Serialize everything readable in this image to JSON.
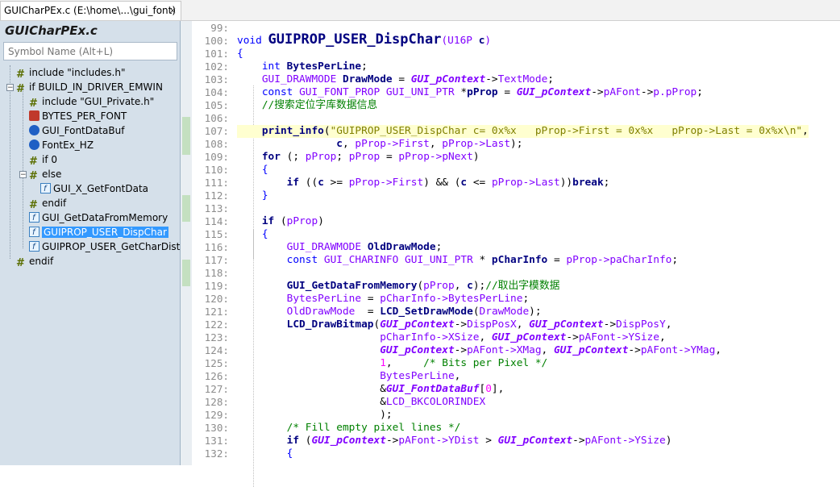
{
  "tab": {
    "title": "GUICharPEx.c (E:\\home\\...\\gui_font)",
    "close": "×"
  },
  "sidebar": {
    "title": "GUICharPEx.c",
    "search_placeholder": "Symbol Name (Alt+L)",
    "items": [
      {
        "label": "include \"includes.h\"",
        "icon": "include-icon"
      },
      {
        "label": "if BUILD_IN_DRIVER_EMWIN",
        "icon": "preprocessor-if-icon"
      },
      {
        "label": "include \"GUI_Private.h\"",
        "icon": "include-icon"
      },
      {
        "label": "BYTES_PER_FONT",
        "icon": "define-icon"
      },
      {
        "label": "GUI_FontDataBuf",
        "icon": "variable-icon"
      },
      {
        "label": "FontEx_HZ",
        "icon": "variable-icon"
      },
      {
        "label": "if 0",
        "icon": "preprocessor-if-icon"
      },
      {
        "label": "else",
        "icon": "preprocessor-else-icon"
      },
      {
        "label": "GUI_X_GetFontData",
        "icon": "function-icon"
      },
      {
        "label": "endif",
        "icon": "preprocessor-endif-icon"
      },
      {
        "label": "GUI_GetDataFromMemory",
        "icon": "function-icon"
      },
      {
        "label": "GUIPROP_USER_DispChar",
        "icon": "function-icon",
        "selected": true
      },
      {
        "label": "GUIPROP_USER_GetCharDist",
        "icon": "function-icon"
      },
      {
        "label": "endif",
        "icon": "preprocessor-endif-icon"
      }
    ]
  },
  "editor": {
    "line_numbers": [
      "99:",
      "100:",
      "101:",
      "102:",
      "103:",
      "104:",
      "105:",
      "106:",
      "107:",
      "108:",
      "109:",
      "110:",
      "111:",
      "112:",
      "113:",
      "114:",
      "115:",
      "116:",
      "117:",
      "118:",
      "119:",
      "120:",
      "121:",
      "122:",
      "123:",
      "124:",
      "125:",
      "126:",
      "127:",
      "128:",
      "129:",
      "130:",
      "131:",
      "132:"
    ],
    "lines": [
      [],
      [
        [
          "kw",
          "void "
        ],
        [
          "fnbig",
          "GUIPROP_USER_DispChar"
        ],
        [
          "mac",
          "(U16P "
        ],
        [
          "kwb",
          "c"
        ],
        [
          "mac",
          ")"
        ]
      ],
      [
        [
          "kw",
          "{"
        ]
      ],
      [
        [
          "op",
          "    "
        ],
        [
          "kw",
          "int "
        ],
        [
          "kwb",
          "BytesPerLine"
        ],
        [
          "op",
          ";"
        ]
      ],
      [
        [
          "op",
          "    "
        ],
        [
          "ty",
          "GUI_DRAWMODE "
        ],
        [
          "kwb",
          "DrawMode "
        ],
        [
          "op",
          "= "
        ],
        [
          "gl",
          "GUI_pContext"
        ],
        [
          "op",
          "->"
        ],
        [
          "mac",
          "TextMode"
        ],
        [
          "op",
          ";"
        ]
      ],
      [
        [
          "op",
          "    "
        ],
        [
          "kw",
          "const "
        ],
        [
          "ty",
          "GUI_FONT_PROP GUI_UNI_PTR "
        ],
        [
          "op",
          "*"
        ],
        [
          "kwb",
          "pProp "
        ],
        [
          "op",
          "= "
        ],
        [
          "gl",
          "GUI_pContext"
        ],
        [
          "op",
          "->"
        ],
        [
          "mac",
          "pAFont"
        ],
        [
          "op",
          "->"
        ],
        [
          "mac",
          "p.pProp"
        ],
        [
          "op",
          ";"
        ]
      ],
      [
        [
          "op",
          "    "
        ],
        [
          "cm",
          "//搜索定位字库数据信息"
        ]
      ],
      [],
      [
        [
          "op",
          "    "
        ],
        [
          "fn",
          "print_info"
        ],
        [
          "op",
          "("
        ],
        [
          "st",
          "\"GUIPROP_USER_DispChar c= 0x%x   pProp->First = 0x%x   pProp->Last = 0x%x\\n\""
        ],
        [
          "op",
          ","
        ]
      ],
      [
        [
          "op",
          "                "
        ],
        [
          "kwb",
          "c"
        ],
        [
          "op",
          ", "
        ],
        [
          "mac",
          "pProp->First"
        ],
        [
          "op",
          ", "
        ],
        [
          "mac",
          "pProp->Last"
        ],
        [
          "op",
          ");"
        ]
      ],
      [
        [
          "op",
          "    "
        ],
        [
          "kwb",
          "for "
        ],
        [
          "op",
          "(; "
        ],
        [
          "mac",
          "pProp"
        ],
        [
          "op",
          "; "
        ],
        [
          "mac",
          "pProp "
        ],
        [
          "op",
          "= "
        ],
        [
          "mac",
          "pProp->pNext"
        ],
        [
          "op",
          ")"
        ]
      ],
      [
        [
          "op",
          "    "
        ],
        [
          "kw",
          "{"
        ]
      ],
      [
        [
          "op",
          "        "
        ],
        [
          "kwb",
          "if "
        ],
        [
          "op",
          "(("
        ],
        [
          "kwb",
          "c "
        ],
        [
          "op",
          ">= "
        ],
        [
          "mac",
          "pProp->First"
        ],
        [
          "op",
          ") && ("
        ],
        [
          "kwb",
          "c "
        ],
        [
          "op",
          "<= "
        ],
        [
          "mac",
          "pProp->Last"
        ],
        [
          "op",
          "))"
        ],
        [
          "kwb",
          "break"
        ],
        [
          "op",
          ";"
        ]
      ],
      [
        [
          "op",
          "    "
        ],
        [
          "kw",
          "}"
        ]
      ],
      [],
      [
        [
          "op",
          "    "
        ],
        [
          "kwb",
          "if "
        ],
        [
          "op",
          "("
        ],
        [
          "mac",
          "pProp"
        ],
        [
          "op",
          ")"
        ]
      ],
      [
        [
          "op",
          "    "
        ],
        [
          "kw",
          "{"
        ]
      ],
      [
        [
          "op",
          "        "
        ],
        [
          "ty",
          "GUI_DRAWMODE "
        ],
        [
          "kwb",
          "OldDrawMode"
        ],
        [
          "op",
          ";"
        ]
      ],
      [
        [
          "op",
          "        "
        ],
        [
          "kw",
          "const "
        ],
        [
          "ty",
          "GUI_CHARINFO GUI_UNI_PTR "
        ],
        [
          "op",
          "* "
        ],
        [
          "kwb",
          "pCharInfo "
        ],
        [
          "op",
          "= "
        ],
        [
          "mac",
          "pProp->paCharInfo"
        ],
        [
          "op",
          ";"
        ]
      ],
      [],
      [
        [
          "op",
          "        "
        ],
        [
          "fn",
          "GUI_GetDataFromMemory"
        ],
        [
          "op",
          "("
        ],
        [
          "mac",
          "pProp"
        ],
        [
          "op",
          ", "
        ],
        [
          "kwb",
          "c"
        ],
        [
          "op",
          ");"
        ],
        [
          "cm",
          "//取出字模数据"
        ]
      ],
      [
        [
          "op",
          "        "
        ],
        [
          "mac",
          "BytesPerLine "
        ],
        [
          "op",
          "= "
        ],
        [
          "mac",
          "pCharInfo->BytesPerLine"
        ],
        [
          "op",
          ";"
        ]
      ],
      [
        [
          "op",
          "        "
        ],
        [
          "mac",
          "OldDrawMode  "
        ],
        [
          "op",
          "= "
        ],
        [
          "fn",
          "LCD_SetDrawMode"
        ],
        [
          "op",
          "("
        ],
        [
          "mac",
          "DrawMode"
        ],
        [
          "op",
          ");"
        ]
      ],
      [
        [
          "op",
          "        "
        ],
        [
          "fn",
          "LCD_DrawBitmap"
        ],
        [
          "op",
          "("
        ],
        [
          "gl",
          "GUI_pContext"
        ],
        [
          "op",
          "->"
        ],
        [
          "mac",
          "DispPosX"
        ],
        [
          "op",
          ", "
        ],
        [
          "gl",
          "GUI_pContext"
        ],
        [
          "op",
          "->"
        ],
        [
          "mac",
          "DispPosY"
        ],
        [
          "op",
          ","
        ]
      ],
      [
        [
          "op",
          "                       "
        ],
        [
          "mac",
          "pCharInfo->XSize"
        ],
        [
          "op",
          ", "
        ],
        [
          "gl",
          "GUI_pContext"
        ],
        [
          "op",
          "->"
        ],
        [
          "mac",
          "pAFont->YSize"
        ],
        [
          "op",
          ","
        ]
      ],
      [
        [
          "op",
          "                       "
        ],
        [
          "gl",
          "GUI_pContext"
        ],
        [
          "op",
          "->"
        ],
        [
          "mac",
          "pAFont->XMag"
        ],
        [
          "op",
          ", "
        ],
        [
          "gl",
          "GUI_pContext"
        ],
        [
          "op",
          "->"
        ],
        [
          "mac",
          "pAFont->YMag"
        ],
        [
          "op",
          ","
        ]
      ],
      [
        [
          "op",
          "                       "
        ],
        [
          "nu",
          "1"
        ],
        [
          "op",
          ",     "
        ],
        [
          "cm",
          "/* Bits per Pixel */"
        ]
      ],
      [
        [
          "op",
          "                       "
        ],
        [
          "mac",
          "BytesPerLine"
        ],
        [
          "op",
          ","
        ]
      ],
      [
        [
          "op",
          "                       &"
        ],
        [
          "gl",
          "GUI_FontDataBuf"
        ],
        [
          "op",
          "["
        ],
        [
          "nu",
          "0"
        ],
        [
          "op",
          "],"
        ]
      ],
      [
        [
          "op",
          "                       &"
        ],
        [
          "mac",
          "LCD_BKCOLORINDEX"
        ]
      ],
      [
        [
          "op",
          "                       );"
        ]
      ],
      [
        [
          "op",
          "        "
        ],
        [
          "cm",
          "/* Fill empty pixel lines */"
        ]
      ],
      [
        [
          "op",
          "        "
        ],
        [
          "kwb",
          "if "
        ],
        [
          "op",
          "("
        ],
        [
          "gl",
          "GUI_pContext"
        ],
        [
          "op",
          "->"
        ],
        [
          "mac",
          "pAFont->YDist "
        ],
        [
          "op",
          "> "
        ],
        [
          "gl",
          "GUI_pContext"
        ],
        [
          "op",
          "->"
        ],
        [
          "mac",
          "pAFont->YSize"
        ],
        [
          "op",
          ")"
        ]
      ],
      [
        [
          "op",
          "        "
        ],
        [
          "kw",
          "{"
        ]
      ]
    ]
  },
  "colors": {
    "sidebar_bg": "#d5e0ea",
    "selection": "#3399ff",
    "change_bar": "#c4e0c0"
  }
}
